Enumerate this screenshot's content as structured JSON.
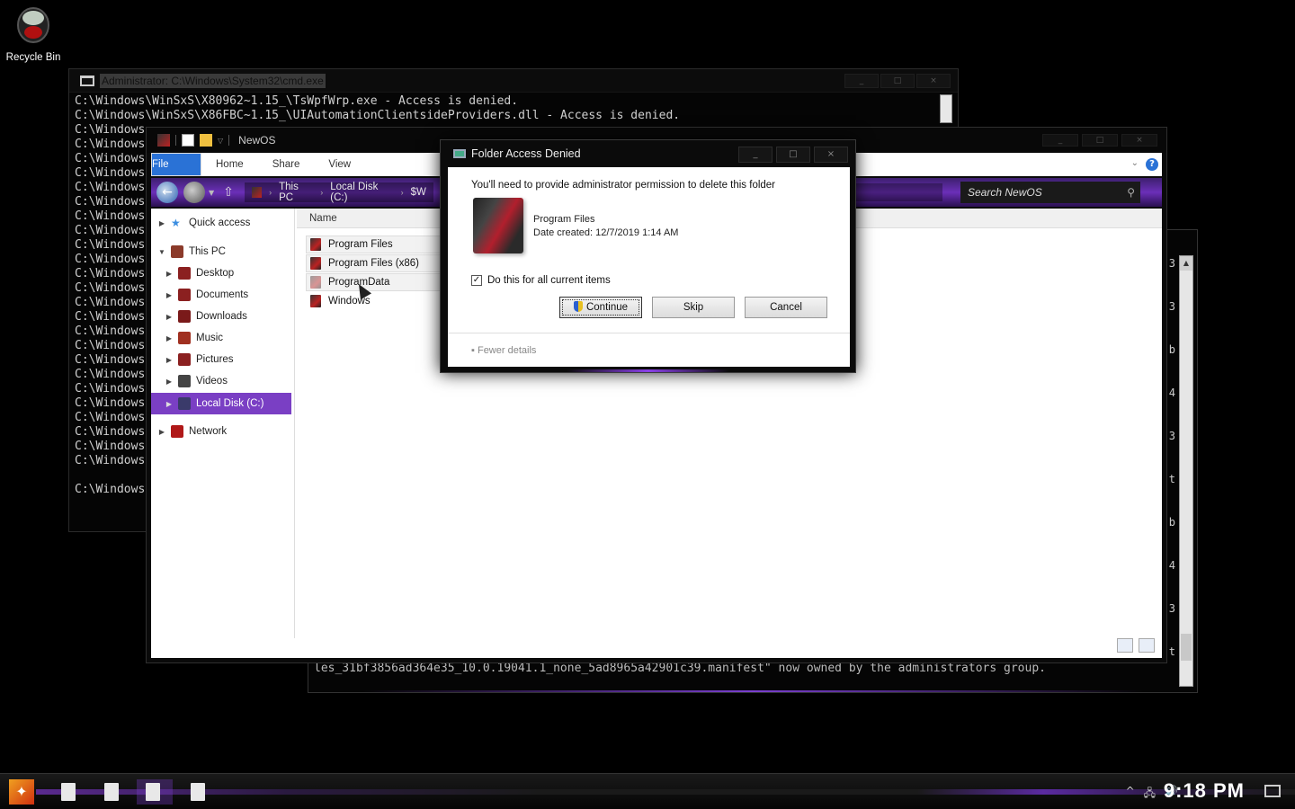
{
  "desktop": {
    "recycle_bin_label": "Recycle Bin"
  },
  "cmd_window": {
    "title": "Administrator: C:\\Windows\\System32\\cmd.exe",
    "lines": [
      "C:\\Windows\\WinSxS\\X80962~1.15_\\TsWpfWrp.exe - Access is denied.",
      "C:\\Windows\\WinSxS\\X86FBC~1.15_\\UIAutomationClientsideProviders.dll - Access is denied.",
      "C:\\Windows",
      "C:\\Windows",
      "C:\\Windows",
      "C:\\Windows",
      "C:\\Windows",
      "C:\\Windows",
      "C:\\Windows",
      "C:\\Windows",
      "C:\\Windows",
      "C:\\Windows",
      "C:\\Windows",
      "C:\\Windows",
      "C:\\Windows",
      "C:\\Windows",
      "C:\\Windows",
      "C:\\Windows",
      "C:\\Windows",
      "C:\\Windows",
      "C:\\Windows",
      "C:\\Windows",
      "C:\\Windows",
      "C:\\Windows",
      "C:\\Windows",
      "C:\\Windows",
      "",
      "C:\\Windows"
    ]
  },
  "cmd_window_2": {
    "bottom_line": "les_31bf3856ad364e35_10.0.19041.1_none_5ad8965a42901c39.manifest\" now owned by the administrators group.",
    "peek_chars": [
      "3",
      "3",
      "b",
      "4",
      "3",
      "t",
      "b",
      "4",
      "3",
      "t"
    ]
  },
  "explorer": {
    "title": "NewOS",
    "ribbon_tabs": [
      "File",
      "Home",
      "Share",
      "View"
    ],
    "breadcrumb": [
      "This PC",
      "Local Disk (C:)",
      "$W"
    ],
    "search_placeholder": "Search NewOS",
    "column_name": "Name",
    "nav_items": [
      {
        "label": "Quick access",
        "expandable": true
      },
      {
        "label": "This PC",
        "expanded": true
      },
      {
        "label": "Desktop"
      },
      {
        "label": "Documents"
      },
      {
        "label": "Downloads"
      },
      {
        "label": "Music"
      },
      {
        "label": "Pictures"
      },
      {
        "label": "Videos"
      },
      {
        "label": "Local Disk (C:)",
        "selected": true
      },
      {
        "label": "Network"
      }
    ],
    "files": [
      "Program Files",
      "Program Files (x86)",
      "ProgramData",
      "Windows"
    ]
  },
  "dialog": {
    "title": "Folder Access Denied",
    "message": "You'll need to provide administrator permission to delete this folder",
    "folder_name": "Program Files",
    "date_created": "Date created: 12/7/2019 1:14 AM",
    "checkbox_label": "Do this for all current items",
    "checkbox_checked": true,
    "buttons": {
      "continue": "Continue",
      "skip": "Skip",
      "cancel": "Cancel"
    },
    "fewer_details": "Fewer details"
  },
  "taskbar": {
    "clock": "9:18 PM"
  }
}
